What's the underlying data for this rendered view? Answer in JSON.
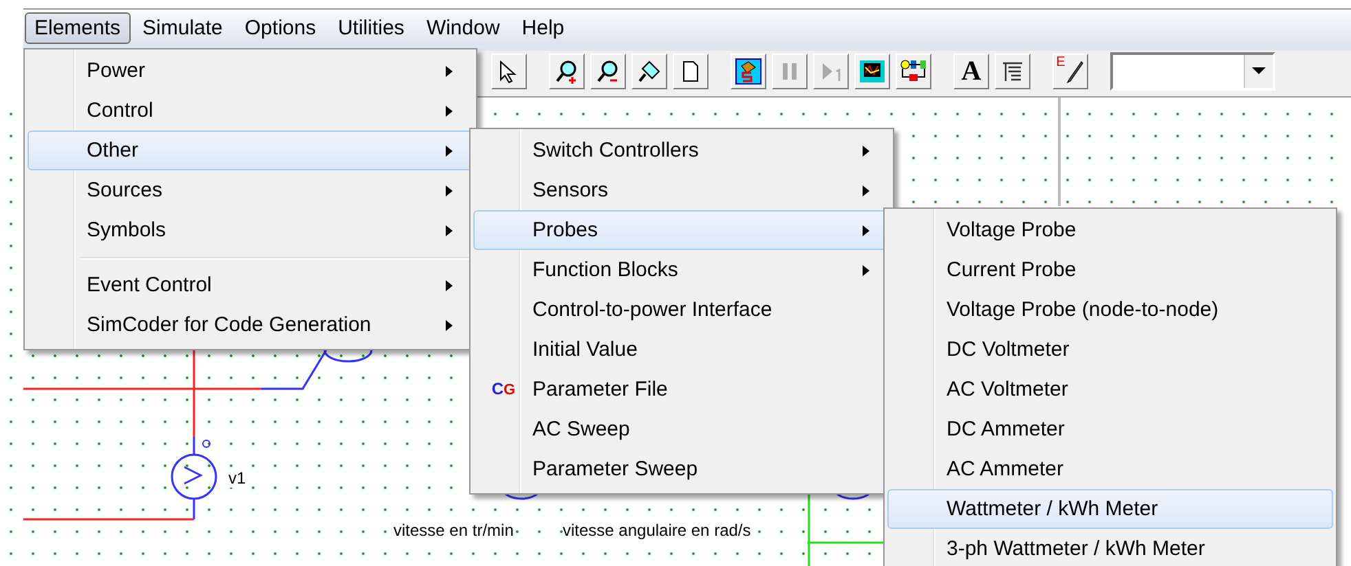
{
  "menubar": [
    {
      "label": "Elements",
      "selected": true
    },
    {
      "label": "Simulate",
      "selected": false
    },
    {
      "label": "Options",
      "selected": false
    },
    {
      "label": "Utilities",
      "selected": false
    },
    {
      "label": "Window",
      "selected": false
    },
    {
      "label": "Help",
      "selected": false
    }
  ],
  "toolbar": [
    {
      "kind": "select",
      "disabled": false
    },
    {
      "kind": "zoom-in",
      "disabled": false
    },
    {
      "kind": "zoom-out",
      "disabled": false
    },
    {
      "kind": "pan",
      "disabled": false
    },
    {
      "kind": "page",
      "disabled": false
    },
    {
      "kind": "run",
      "disabled": false
    },
    {
      "kind": "pause",
      "disabled": true
    },
    {
      "kind": "step",
      "disabled": true
    },
    {
      "kind": "scope",
      "disabled": false
    },
    {
      "kind": "blocks",
      "disabled": false
    },
    {
      "kind": "letter",
      "label": "A",
      "disabled": false
    },
    {
      "kind": "text-list",
      "disabled": false
    },
    {
      "kind": "edit",
      "label": "E",
      "disabled": false
    },
    {
      "kind": "dropdown"
    }
  ],
  "menus": [
    {
      "items": [
        {
          "kind": "item",
          "label": "Power",
          "submenu": true,
          "selected": false
        },
        {
          "kind": "item",
          "label": "Control",
          "submenu": true,
          "selected": false
        },
        {
          "kind": "item",
          "label": "Other",
          "submenu": true,
          "selected": true
        },
        {
          "kind": "item",
          "label": "Sources",
          "submenu": true,
          "selected": false
        },
        {
          "kind": "item",
          "label": "Symbols",
          "submenu": true,
          "selected": false
        },
        {
          "kind": "separator"
        },
        {
          "kind": "item",
          "label": "Event Control",
          "submenu": true,
          "selected": false
        },
        {
          "kind": "item",
          "label": "SimCoder for Code Generation",
          "submenu": true,
          "selected": false
        }
      ]
    },
    {
      "items": [
        {
          "kind": "item",
          "label": "Switch Controllers",
          "submenu": true,
          "selected": false
        },
        {
          "kind": "item",
          "label": "Sensors",
          "submenu": true,
          "selected": false
        },
        {
          "kind": "item",
          "label": "Probes",
          "submenu": true,
          "selected": true
        },
        {
          "kind": "item",
          "label": "Function Blocks",
          "submenu": true,
          "selected": false
        },
        {
          "kind": "item",
          "label": "Control-to-power Interface",
          "submenu": false,
          "selected": false
        },
        {
          "kind": "item",
          "label": "Initial Value",
          "submenu": false,
          "selected": false
        },
        {
          "kind": "item",
          "label": "Parameter File",
          "submenu": false,
          "selected": false,
          "icon_text": "CG"
        },
        {
          "kind": "item",
          "label": "AC Sweep",
          "submenu": false,
          "selected": false
        },
        {
          "kind": "item",
          "label": "Parameter Sweep",
          "submenu": false,
          "selected": false
        }
      ]
    },
    {
      "items": [
        {
          "kind": "item",
          "label": "Voltage Probe",
          "submenu": false,
          "selected": false
        },
        {
          "kind": "item",
          "label": "Current Probe",
          "submenu": false,
          "selected": false
        },
        {
          "kind": "item",
          "label": "Voltage Probe (node-to-node)",
          "submenu": false,
          "selected": false
        },
        {
          "kind": "item",
          "label": "DC Voltmeter",
          "submenu": false,
          "selected": false
        },
        {
          "kind": "item",
          "label": "AC Voltmeter",
          "submenu": false,
          "selected": false
        },
        {
          "kind": "item",
          "label": "DC Ammeter",
          "submenu": false,
          "selected": false
        },
        {
          "kind": "item",
          "label": "AC Ammeter",
          "submenu": false,
          "selected": false
        },
        {
          "kind": "item",
          "label": "Wattmeter / kWh Meter",
          "submenu": false,
          "selected": true
        },
        {
          "kind": "item",
          "label": "3-ph Wattmeter / kWh Meter",
          "submenu": false,
          "selected": false
        }
      ]
    }
  ],
  "canvas": {
    "labels": [
      "v1",
      "vitesse en tr/min",
      "vitesse angulaire en rad/s"
    ]
  }
}
